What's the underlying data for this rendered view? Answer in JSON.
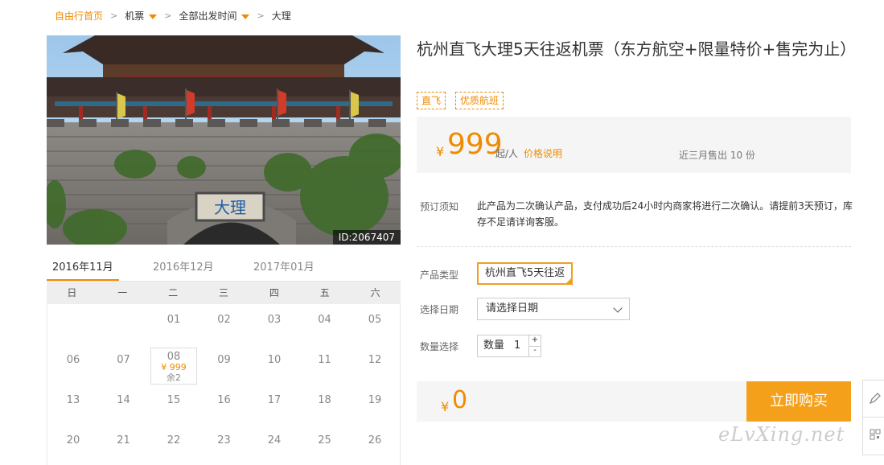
{
  "breadcrumb": {
    "home": "自由行首页",
    "category": "机票",
    "departure": "全部出发时间",
    "destination": "大理"
  },
  "photo": {
    "id_label": "ID:2067407",
    "sign_text": "大理"
  },
  "calendar": {
    "tabs": [
      "2016年11月",
      "2016年12月",
      "2017年01月"
    ],
    "active_tab": 0,
    "weekdays": [
      "日",
      "一",
      "二",
      "三",
      "四",
      "五",
      "六"
    ],
    "rows": [
      [
        "",
        "",
        "01",
        "02",
        "03",
        "04",
        "05"
      ],
      [
        "06",
        "07",
        "08",
        "09",
        "10",
        "11",
        "12"
      ],
      [
        "13",
        "14",
        "15",
        "16",
        "17",
        "18",
        "19"
      ],
      [
        "20",
        "21",
        "22",
        "23",
        "24",
        "25",
        "26"
      ]
    ],
    "available_day": {
      "day": "08",
      "price": "¥ 999",
      "remaining": "余2"
    }
  },
  "product": {
    "title": "杭州直飞大理5天往返机票（东方航空+限量特价+售完为止）",
    "tags": [
      "直飞",
      "优质航班"
    ],
    "currency": "¥",
    "price": "999",
    "price_unit": "起/人",
    "price_note_link": "价格说明",
    "sold": "近三月售出 10 份"
  },
  "booking_notice": {
    "label": "预订须知",
    "text": "此产品为二次确认产品，支付成功后24小时内商家将进行二次确认。请提前3天预订，库存不足请详询客服。"
  },
  "form": {
    "product_type_label": "产品类型",
    "product_type_option": "杭州直飞5天往返",
    "date_label": "选择日期",
    "date_placeholder": "请选择日期",
    "quantity_label": "数量选择",
    "quantity_text": "数量",
    "quantity_value": "1",
    "plus": "+",
    "minus": "-"
  },
  "total": {
    "currency": "¥",
    "amount": "0",
    "buy_label": "立即购买"
  },
  "watermark": "eLvXing.net",
  "colors": {
    "accent": "#f08a00",
    "buy_button": "#f5a01a",
    "panel": "#f5f5f5"
  }
}
